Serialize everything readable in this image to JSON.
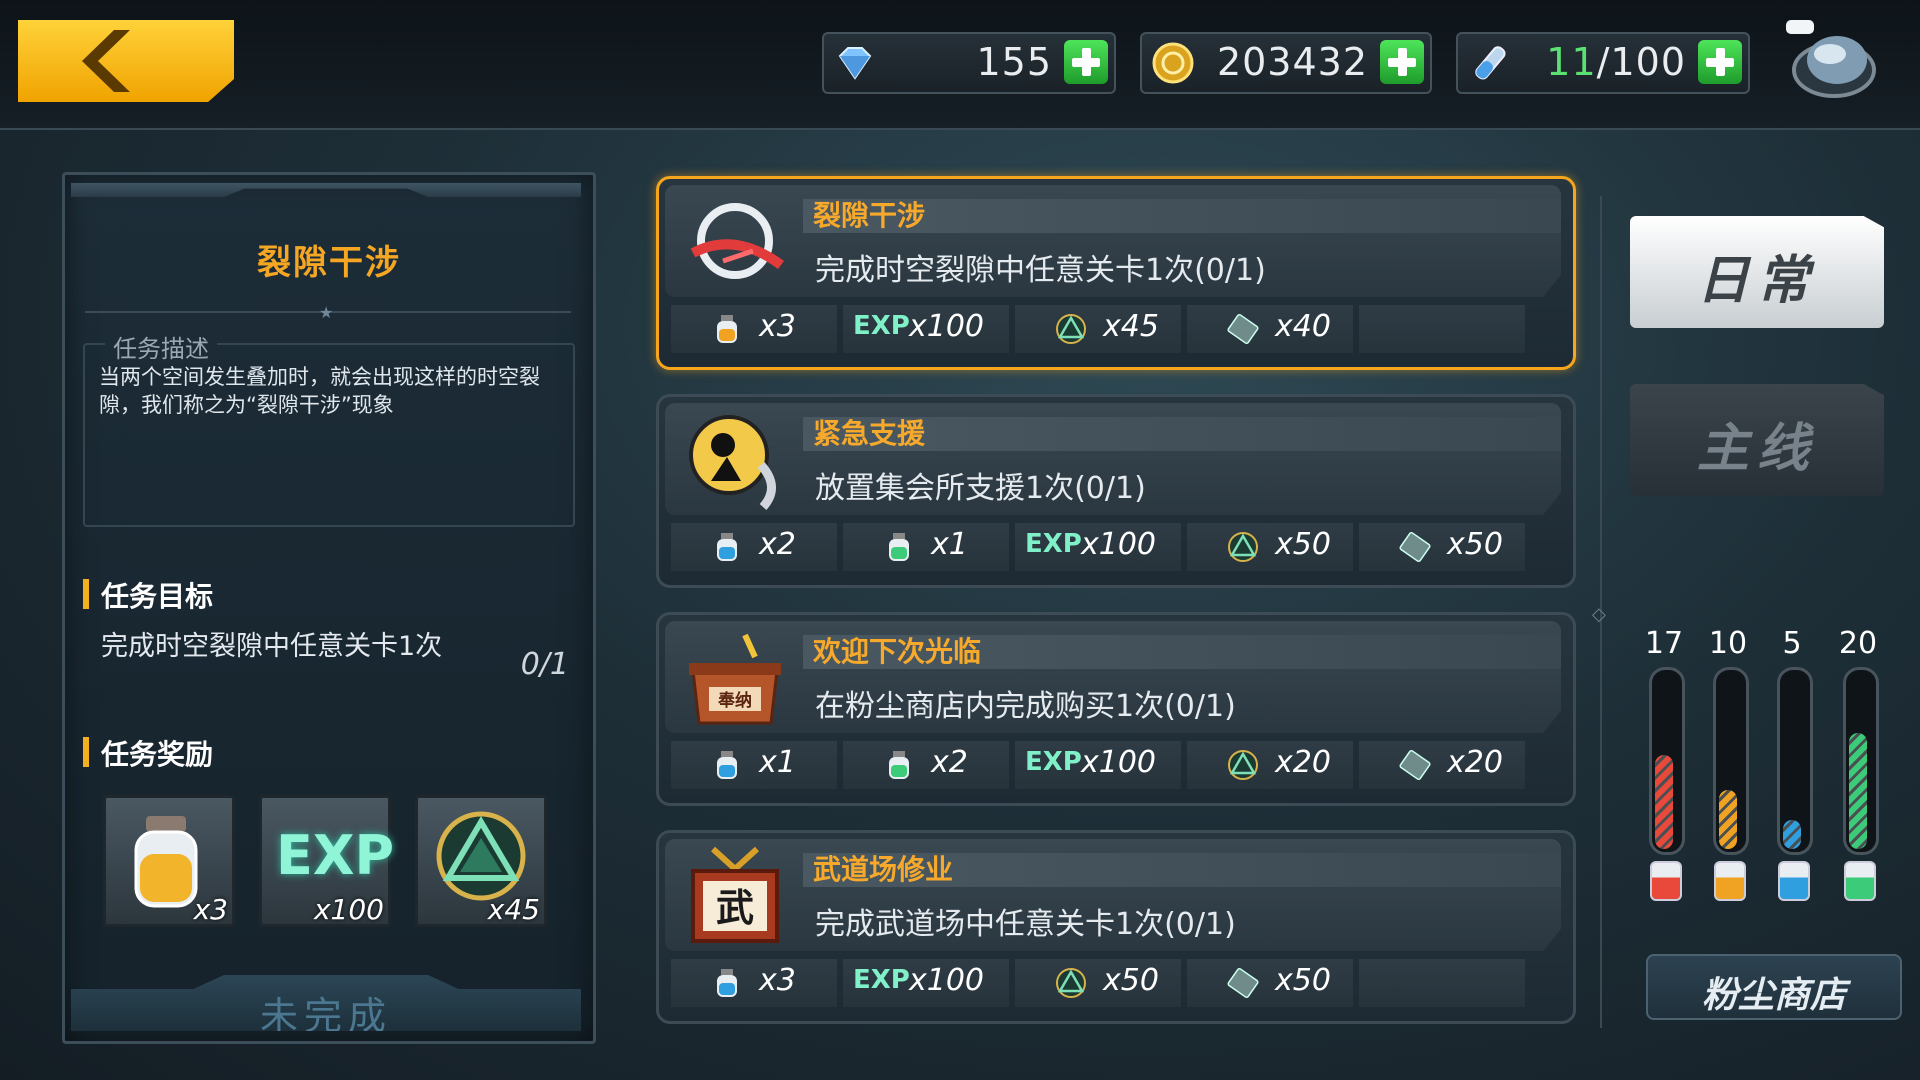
{
  "resources": {
    "gems": "155",
    "coins": "203432",
    "stamina_current": "11",
    "stamina_max": "/100"
  },
  "detail": {
    "title": "裂隙干涉",
    "desc_label": "任务描述",
    "description": "当两个空间发生叠加时，就会出现这样的时空裂隙，我们称之为“裂隙干涉”现象",
    "goal_heading": "任务目标",
    "goal_text": "完成时空裂隙中任意关卡1次",
    "goal_progress": "0/1",
    "reward_heading": "任务奖励",
    "rewards": [
      {
        "icon": "potion-jar-icon",
        "qty": "x3"
      },
      {
        "icon": "exp-icon",
        "label": "EXP",
        "qty": "x100"
      },
      {
        "icon": "emblem-icon",
        "qty": "x45"
      }
    ],
    "status": "未完成"
  },
  "missions": [
    {
      "title": "裂隙干涉",
      "desc": "完成时空裂隙中任意关卡1次(0/1)",
      "icon": "rift-icon",
      "rewards": [
        {
          "type": "orange-potion",
          "qty": "x3"
        },
        {
          "type": "exp",
          "label": "EXP",
          "qty": "x100"
        },
        {
          "type": "emblem",
          "qty": "x45"
        },
        {
          "type": "ticket",
          "qty": "x40"
        }
      ]
    },
    {
      "title": "紧急支援",
      "desc": "放置集会所支援1次(0/1)",
      "icon": "support-call-icon",
      "rewards": [
        {
          "type": "blue-potion",
          "qty": "x2"
        },
        {
          "type": "green-potion",
          "qty": "x1"
        },
        {
          "type": "exp",
          "label": "EXP",
          "qty": "x100"
        },
        {
          "type": "emblem",
          "qty": "x50"
        },
        {
          "type": "ticket",
          "qty": "x50"
        }
      ]
    },
    {
      "title": "欢迎下次光临",
      "desc": "在粉尘商店内完成购买1次(0/1)",
      "icon": "donation-box-icon",
      "icon_text": "奉纳",
      "rewards": [
        {
          "type": "blue-potion",
          "qty": "x1"
        },
        {
          "type": "green-potion",
          "qty": "x2"
        },
        {
          "type": "exp",
          "label": "EXP",
          "qty": "x100"
        },
        {
          "type": "emblem",
          "qty": "x20"
        },
        {
          "type": "ticket",
          "qty": "x20"
        }
      ]
    },
    {
      "title": "武道场修业",
      "desc": "完成武道场中任意关卡1次(0/1)",
      "icon": "dojo-sign-icon",
      "icon_text": "武",
      "rewards": [
        {
          "type": "blue-potion",
          "qty": "x3"
        },
        {
          "type": "exp",
          "label": "EXP",
          "qty": "x100"
        },
        {
          "type": "emblem",
          "qty": "x50"
        },
        {
          "type": "ticket",
          "qty": "x50"
        }
      ]
    }
  ],
  "tabs": {
    "daily": "日常",
    "main": "主线"
  },
  "dust_gauges": [
    {
      "value": "17",
      "level": 0.55,
      "color": "#e8493a"
    },
    {
      "value": "10",
      "level": 0.35,
      "color": "#f0a322"
    },
    {
      "value": "5",
      "level": 0.17,
      "color": "#2f9fe0"
    },
    {
      "value": "20",
      "level": 0.68,
      "color": "#3ccb78"
    }
  ],
  "shop_button": "粉尘商店",
  "colors": {
    "accent_orange": "#f6a92b",
    "active_border": "#f7a51c",
    "plus_green": "#2ec441"
  }
}
